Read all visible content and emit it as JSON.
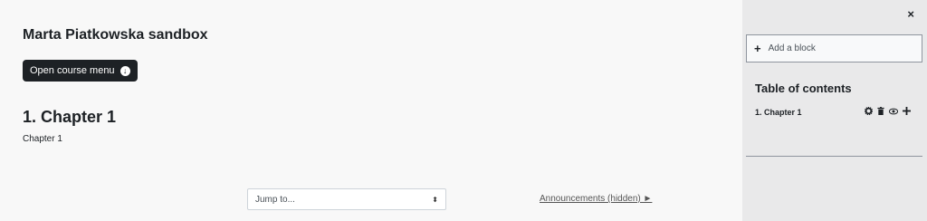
{
  "course": {
    "title": "Marta Piatkowska sandbox",
    "menu_button_label": "Open course menu",
    "menu_button_icon": "arrow-circle-down-icon"
  },
  "section": {
    "title": "1. Chapter 1",
    "subtitle": "Chapter 1"
  },
  "footer_nav": {
    "jump_to_value": "Jump to...",
    "next_link_label": "Announcements (hidden) ►"
  },
  "drawer": {
    "close_glyph": "×",
    "add_block_label": "Add a block",
    "toc_title": "Table of contents",
    "toc_items": [
      {
        "label": "1. Chapter 1"
      }
    ]
  }
}
